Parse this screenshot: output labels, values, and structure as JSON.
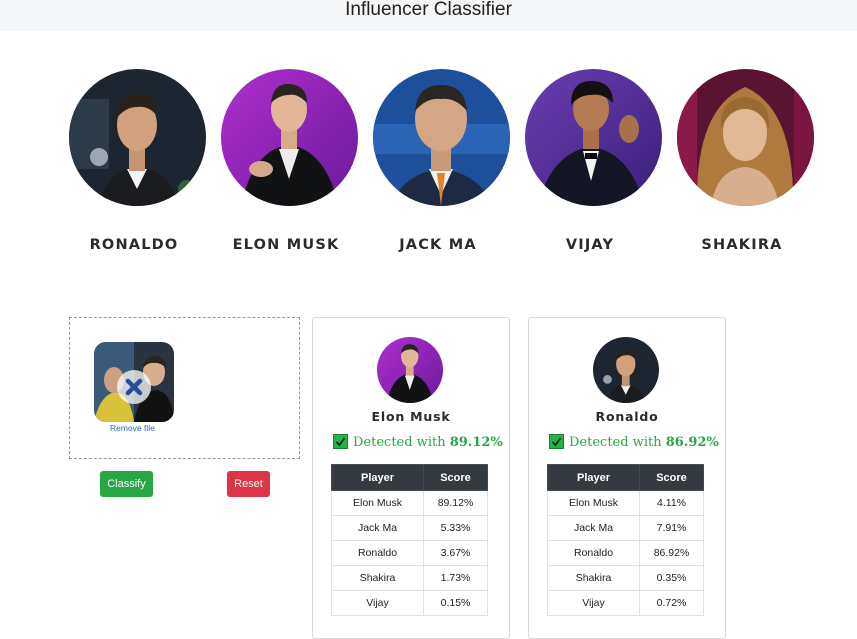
{
  "header": {
    "title": "Influencer Classifier"
  },
  "people": [
    {
      "name": "RONALDO"
    },
    {
      "name": "ELON MUSK"
    },
    {
      "name": "JACK MA"
    },
    {
      "name": "VIJAY"
    },
    {
      "name": "SHAKIRA"
    }
  ],
  "upload": {
    "remove_label": "Remove file"
  },
  "buttons": {
    "classify": "Classify",
    "reset": "Reset"
  },
  "results": [
    {
      "name": "Elon Musk",
      "detected_prefix": "Detected with",
      "detected_value": "89.12%",
      "headers": [
        "Player",
        "Score"
      ],
      "rows": [
        [
          "Elon Musk",
          "89.12%"
        ],
        [
          "Jack Ma",
          "5.33%"
        ],
        [
          "Ronaldo",
          "3.67%"
        ],
        [
          "Shakira",
          "1.73%"
        ],
        [
          "Vijay",
          "0.15%"
        ]
      ]
    },
    {
      "name": "Ronaldo",
      "detected_prefix": "Detected with",
      "detected_value": "86.92%",
      "headers": [
        "Player",
        "Score"
      ],
      "rows": [
        [
          "Elon Musk",
          "4.11%"
        ],
        [
          "Jack Ma",
          "7.91%"
        ],
        [
          "Ronaldo",
          "86.92%"
        ],
        [
          "Shakira",
          "0.35%"
        ],
        [
          "Vijay",
          "0.72%"
        ]
      ]
    }
  ],
  "colors": {
    "success": "#28a745",
    "danger": "#dc3545",
    "table_header": "#343a40"
  }
}
